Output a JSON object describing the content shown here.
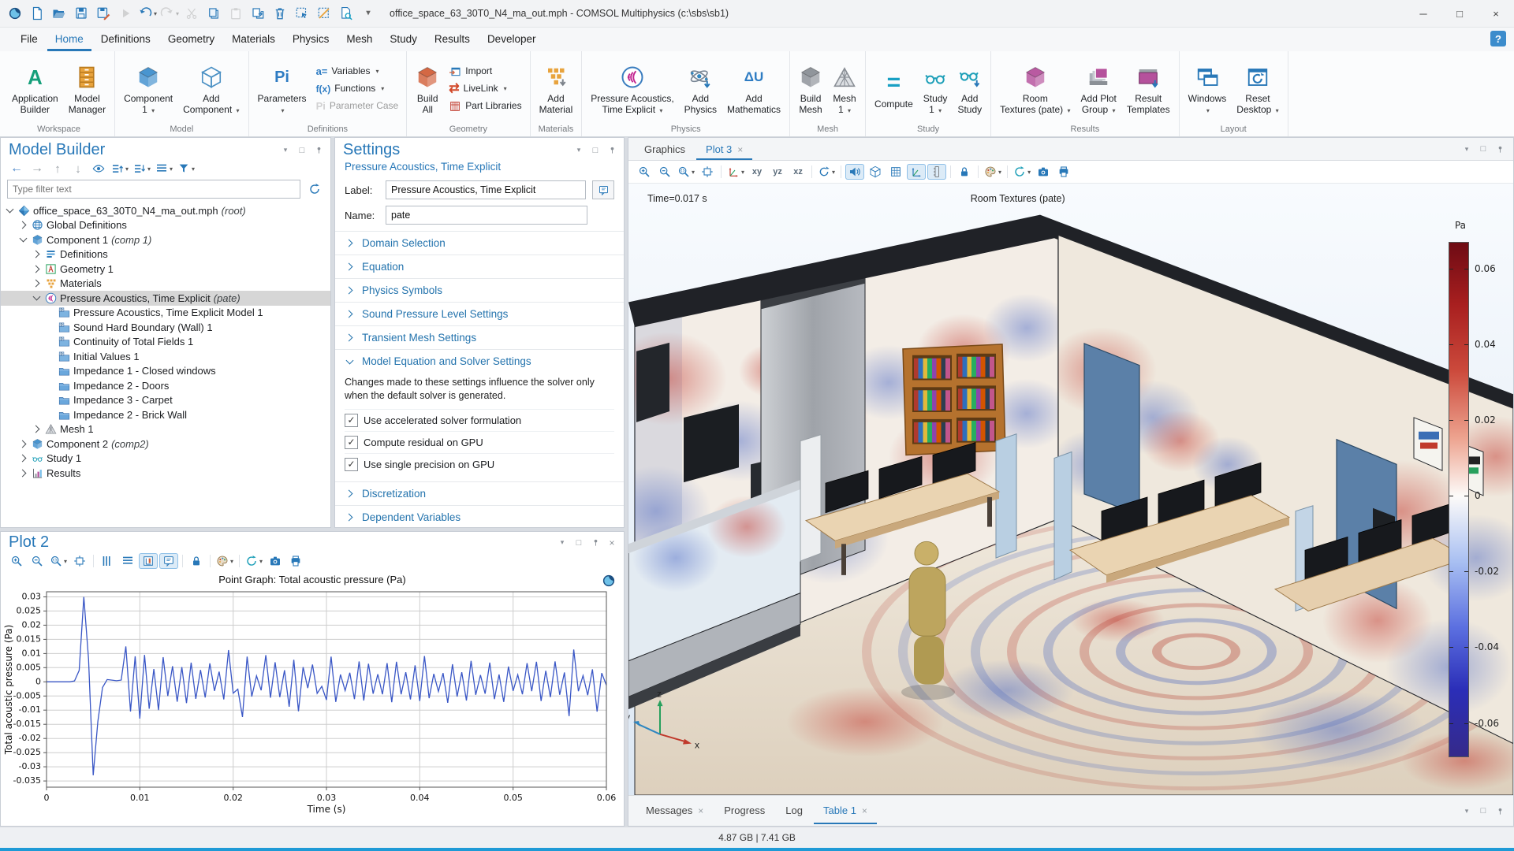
{
  "titlebar": {
    "title": "office_space_63_30T0_N4_ma_out.mph - COMSOL Multiphysics (c:\\sbs\\sb1)",
    "quick_access": [
      {
        "name": "comsol-logo",
        "interactable": false
      },
      {
        "name": "new-file"
      },
      {
        "name": "open-file"
      },
      {
        "name": "save"
      },
      {
        "name": "save-as"
      },
      {
        "name": "run",
        "disabled": true
      },
      {
        "name": "undo",
        "dropdown": true
      },
      {
        "name": "redo",
        "dropdown": true,
        "disabled": true
      },
      {
        "name": "cut",
        "disabled": true
      },
      {
        "name": "copy"
      },
      {
        "name": "paste",
        "disabled": true
      },
      {
        "name": "duplicate"
      },
      {
        "name": "delete"
      },
      {
        "name": "select-box"
      },
      {
        "name": "clear-selection"
      },
      {
        "name": "view-report"
      },
      {
        "name": "more-commands"
      }
    ],
    "window_buttons": [
      "minimize",
      "maximize",
      "close"
    ],
    "window_glyphs": [
      "─",
      "□",
      "×"
    ]
  },
  "menubar": {
    "items": [
      "File",
      "Home",
      "Definitions",
      "Geometry",
      "Materials",
      "Physics",
      "Mesh",
      "Study",
      "Results",
      "Developer"
    ],
    "active": "Home",
    "help": "?"
  },
  "ribbon": {
    "groups": [
      {
        "label": "Workspace",
        "big": [
          {
            "lines": [
              "Application",
              "Builder"
            ],
            "icon": "application-builder"
          },
          {
            "lines": [
              "Model",
              "Manager"
            ],
            "icon": "model-manager"
          }
        ]
      },
      {
        "label": "Model",
        "big": [
          {
            "lines": [
              "Component",
              "1"
            ],
            "caret": true,
            "icon": "component"
          },
          {
            "lines": [
              "Add",
              "Component"
            ],
            "caret": true,
            "icon": "add-component"
          }
        ]
      },
      {
        "label": "Definitions",
        "big": [
          {
            "lines": [
              "Parameters",
              ""
            ],
            "caret": true,
            "icon": "parameters"
          }
        ],
        "small": [
          {
            "label": "Variables",
            "caret": true,
            "icon": "variables"
          },
          {
            "label": "Functions",
            "caret": true,
            "icon": "functions"
          },
          {
            "label": "Parameter Case",
            "icon": "parameter-case",
            "disabled": true
          }
        ]
      },
      {
        "label": "Geometry",
        "big": [
          {
            "lines": [
              "Build",
              "All"
            ],
            "icon": "build-all"
          }
        ],
        "small": [
          {
            "label": "Import",
            "icon": "import"
          },
          {
            "label": "LiveLink",
            "caret": true,
            "icon": "livelink"
          },
          {
            "label": "Part Libraries",
            "icon": "part-libraries"
          }
        ]
      },
      {
        "label": "Materials",
        "big": [
          {
            "lines": [
              "Add",
              "Material"
            ],
            "icon": "add-material"
          }
        ]
      },
      {
        "label": "Physics",
        "big": [
          {
            "lines": [
              "Pressure Acoustics,",
              "Time Explicit"
            ],
            "caret": true,
            "icon": "pressure-acoustics"
          },
          {
            "lines": [
              "Add",
              "Physics"
            ],
            "icon": "add-physics"
          },
          {
            "lines": [
              "Add",
              "Mathematics"
            ],
            "icon": "add-mathematics"
          }
        ]
      },
      {
        "label": "Mesh",
        "big": [
          {
            "lines": [
              "Build",
              "Mesh"
            ],
            "icon": "build-mesh"
          },
          {
            "lines": [
              "Mesh",
              "1"
            ],
            "caret": true,
            "icon": "mesh"
          }
        ]
      },
      {
        "label": "Study",
        "big": [
          {
            "lines": [
              "Compute"
            ],
            "icon": "compute"
          },
          {
            "lines": [
              "Study",
              "1"
            ],
            "caret": true,
            "icon": "study"
          },
          {
            "lines": [
              "Add",
              "Study"
            ],
            "icon": "add-study"
          }
        ]
      },
      {
        "label": "Results",
        "big": [
          {
            "lines": [
              "Room",
              "Textures (pate)"
            ],
            "caret": true,
            "icon": "room-textures"
          },
          {
            "lines": [
              "Add Plot",
              "Group"
            ],
            "caret": true,
            "icon": "add-plot-group"
          },
          {
            "lines": [
              "Result",
              "Templates"
            ],
            "icon": "result-templates"
          }
        ]
      },
      {
        "label": "Layout",
        "big": [
          {
            "lines": [
              "Windows",
              ""
            ],
            "caret": true,
            "icon": "windows"
          },
          {
            "lines": [
              "Reset",
              "Desktop"
            ],
            "caret": true,
            "icon": "reset-desktop"
          }
        ]
      }
    ]
  },
  "model_builder": {
    "title": "Model Builder",
    "toolbar": [
      {
        "name": "nav-back"
      },
      {
        "name": "nav-forward"
      },
      {
        "name": "move-up"
      },
      {
        "name": "move-down"
      },
      {
        "name": "show"
      },
      {
        "name": "collapse-all",
        "dropdown": true
      },
      {
        "name": "expand-all",
        "dropdown": true
      },
      {
        "name": "tree-options",
        "dropdown": true
      },
      {
        "name": "filter-view",
        "dropdown": true
      }
    ],
    "filter_placeholder": "Type filter text",
    "tree": [
      {
        "level": 0,
        "exp": "open",
        "icon": "root",
        "label": "office_space_63_30T0_N4_ma_out.mph",
        "suffix": "(root)"
      },
      {
        "level": 1,
        "exp": "closed",
        "icon": "globe",
        "label": "Global Definitions"
      },
      {
        "level": 1,
        "exp": "open",
        "icon": "cube",
        "label": "Component 1",
        "suffix": "(comp 1)"
      },
      {
        "level": 2,
        "exp": "closed",
        "icon": "defs",
        "label": "Definitions"
      },
      {
        "level": 2,
        "exp": "closed",
        "icon": "geom",
        "label": "Geometry 1"
      },
      {
        "level": 2,
        "exp": "closed",
        "icon": "mat",
        "label": "Materials"
      },
      {
        "level": 2,
        "exp": "open",
        "icon": "wave",
        "label": "Pressure Acoustics, Time Explicit",
        "suffix": "(pate)",
        "selected": true
      },
      {
        "level": 3,
        "icon": "dfolder",
        "label": "Pressure Acoustics, Time Explicit Model 1"
      },
      {
        "level": 3,
        "icon": "dfolder",
        "label": "Sound Hard Boundary (Wall) 1"
      },
      {
        "level": 3,
        "icon": "dfolder",
        "label": "Continuity of Total Fields 1"
      },
      {
        "level": 3,
        "icon": "dfolder",
        "label": "Initial Values 1"
      },
      {
        "level": 3,
        "icon": "folder",
        "label": "Impedance 1 - Closed windows"
      },
      {
        "level": 3,
        "icon": "folder",
        "label": "Impedance 2 - Doors"
      },
      {
        "level": 3,
        "icon": "folder",
        "label": "Impedance 3 - Carpet"
      },
      {
        "level": 3,
        "icon": "folder",
        "label": "Impedance 2 - Brick Wall"
      },
      {
        "level": 2,
        "exp": "closed",
        "icon": "mesh",
        "label": "Mesh 1"
      },
      {
        "level": 1,
        "exp": "closed",
        "icon": "cube",
        "label": "Component 2",
        "suffix": "(comp2)"
      },
      {
        "level": 1,
        "exp": "closed",
        "icon": "study",
        "label": "Study 1"
      },
      {
        "level": 1,
        "exp": "closed",
        "icon": "results",
        "label": "Results"
      }
    ]
  },
  "settings": {
    "title": "Settings",
    "subtitle": "Pressure Acoustics, Time Explicit",
    "fields": {
      "label": {
        "caption": "Label:",
        "value": "Pressure Acoustics, Time Explicit"
      },
      "name": {
        "caption": "Name:",
        "value": "pate"
      }
    },
    "sections": [
      {
        "label": "Domain Selection"
      },
      {
        "label": "Equation"
      },
      {
        "label": "Physics Symbols"
      },
      {
        "label": "Sound Pressure Level Settings"
      },
      {
        "label": "Transient Mesh Settings"
      },
      {
        "label": "Model Equation and Solver Settings",
        "expanded": true,
        "note": "Changes made to these settings influence the solver only when the default solver is generated.",
        "checkboxes": [
          {
            "label": "Use accelerated solver formulation",
            "checked": true
          },
          {
            "label": "Compute residual on GPU",
            "checked": true
          },
          {
            "label": "Use single precision on GPU",
            "checked": true
          }
        ]
      },
      {
        "label": "Discretization"
      },
      {
        "label": "Dependent Variables"
      }
    ]
  },
  "plot2": {
    "title": "Plot 2",
    "toolbar": [
      {
        "name": "zoom-in"
      },
      {
        "name": "zoom-out"
      },
      {
        "name": "zoom-box",
        "dropdown": true
      },
      {
        "name": "zoom-extents"
      },
      {
        "name": "sep"
      },
      {
        "name": "grid-lines"
      },
      {
        "name": "axis-limits"
      },
      {
        "name": "show-axes",
        "active": true
      },
      {
        "name": "show-annotations",
        "active": true
      },
      {
        "name": "sep"
      },
      {
        "name": "lock-axes"
      },
      {
        "name": "sep"
      },
      {
        "name": "color-theme",
        "dropdown": true
      },
      {
        "name": "sep"
      },
      {
        "name": "update-plot",
        "dropdown": true
      },
      {
        "name": "snapshot"
      },
      {
        "name": "print"
      }
    ]
  },
  "chart_data": {
    "type": "line",
    "title": "Point Graph: Total acoustic pressure (Pa)",
    "xlabel": "Time (s)",
    "ylabel": "Total acoustic pressure (Pa)",
    "xlim": [
      0,
      0.06
    ],
    "ylim": [
      -0.035,
      0.03
    ],
    "xticks": [
      "0",
      "0.01",
      "0.02",
      "0.03",
      "0.04",
      "0.05",
      "0.06"
    ],
    "yticks": [
      "0.03",
      "0.025",
      "0.02",
      "0.015",
      "0.01",
      "0.005",
      "0",
      "-0.005",
      "-0.01",
      "-0.015",
      "-0.02",
      "-0.025",
      "-0.03",
      "-0.035"
    ],
    "grid": true,
    "line_color": "#3a57c6",
    "legend_position": "none",
    "series": [
      {
        "name": "Total acoustic pressure",
        "dt": 0.0005,
        "x_start": 0,
        "values": [
          0,
          0,
          0,
          0,
          0,
          0,
          0.0003,
          0.004,
          0.03,
          0.008,
          -0.033,
          -0.014,
          -0.002,
          0.0008,
          0.0006,
          0.0004,
          0.0006,
          0.0125,
          -0.0105,
          0.009,
          -0.013,
          0.0095,
          -0.0095,
          0.0045,
          -0.01,
          0.0087,
          -0.005,
          0.0055,
          -0.007,
          0.0052,
          -0.0075,
          0.0068,
          -0.006,
          0.0042,
          -0.0055,
          0.0065,
          -0.0032,
          0.0036,
          -0.0062,
          0.0112,
          -0.004,
          -0.0026,
          -0.0124,
          0.0089,
          -0.0052,
          0.0021,
          -0.003,
          0.0094,
          -0.0056,
          0.0069,
          -0.0054,
          0.0041,
          -0.0088,
          0.0078,
          -0.0104,
          0.0052,
          -0.0022,
          0.0061,
          -0.0041,
          -0.0016,
          -0.0064,
          0.0089,
          -0.0071,
          0.0026,
          -0.0031,
          0.0032,
          -0.0061,
          0.0072,
          -0.0066,
          0.0064,
          -0.0042,
          0.0027,
          -0.0044,
          0.0066,
          -0.0072,
          0.0071,
          -0.0044,
          0.0034,
          -0.0062,
          0.0058,
          -0.0068,
          0.0091,
          -0.0058,
          0.0028,
          -0.0034,
          0.0031,
          -0.0074,
          0.0062,
          -0.0052,
          0.0034,
          -0.0066,
          0.0074,
          -0.0046,
          0.0024,
          -0.0042,
          0.0068,
          -0.0061,
          0.0026,
          -0.0071,
          0.0054,
          -0.0032,
          0.0025,
          -0.0044,
          0.0066,
          -0.0033,
          0.0071,
          -0.0068,
          0.0039,
          -0.0054,
          0.0072,
          -0.0046,
          0.0033,
          -0.0121,
          0.0114,
          -0.0033,
          0.0022,
          -0.0047,
          0.0044,
          -0.0105,
          0.0031,
          -0.0012
        ]
      }
    ]
  },
  "graphics": {
    "tabs": [
      {
        "label": "Graphics",
        "active": false
      },
      {
        "label": "Plot 3",
        "active": true,
        "closable": true
      }
    ],
    "toolbar": [
      {
        "name": "zoom-in"
      },
      {
        "name": "zoom-out"
      },
      {
        "name": "zoom-box",
        "dropdown": true
      },
      {
        "name": "zoom-extents"
      },
      {
        "name": "sep"
      },
      {
        "name": "view-orientation",
        "dropdown": true
      },
      {
        "name": "view-xy"
      },
      {
        "name": "view-yz"
      },
      {
        "name": "view-xz"
      },
      {
        "name": "sep"
      },
      {
        "name": "rotate",
        "dropdown": true
      },
      {
        "name": "sep"
      },
      {
        "name": "sound",
        "active": true
      },
      {
        "name": "transparency"
      },
      {
        "name": "wireframe-grid"
      },
      {
        "name": "scene-axes",
        "active": true
      },
      {
        "name": "color-legend",
        "active": true
      },
      {
        "name": "sep"
      },
      {
        "name": "lock-view"
      },
      {
        "name": "sep"
      },
      {
        "name": "color-theme",
        "dropdown": true
      },
      {
        "name": "sep"
      },
      {
        "name": "update-plot",
        "dropdown": true
      },
      {
        "name": "snapshot"
      },
      {
        "name": "print"
      }
    ],
    "overlay": {
      "time": "Time=0.017 s",
      "title": "Room Textures (pate)"
    },
    "colorbar": {
      "unit": "Pa",
      "ticks": [
        "0.06",
        "0.04",
        "0.02",
        "0",
        "-0.02",
        "-0.04",
        "-0.06"
      ],
      "top_color": "#6e0b14",
      "zero_color": "#fdfbf9",
      "bottom_color": "#352a8a"
    },
    "triad": {
      "x": "x",
      "y": "y",
      "z": "z"
    }
  },
  "bottom_panel": {
    "tabs": [
      {
        "label": "Messages",
        "closable": true
      },
      {
        "label": "Progress"
      },
      {
        "label": "Log"
      },
      {
        "label": "Table 1",
        "active": true,
        "closable": true
      }
    ]
  },
  "statusbar": {
    "memory": "4.87 GB | 7.41 GB"
  }
}
